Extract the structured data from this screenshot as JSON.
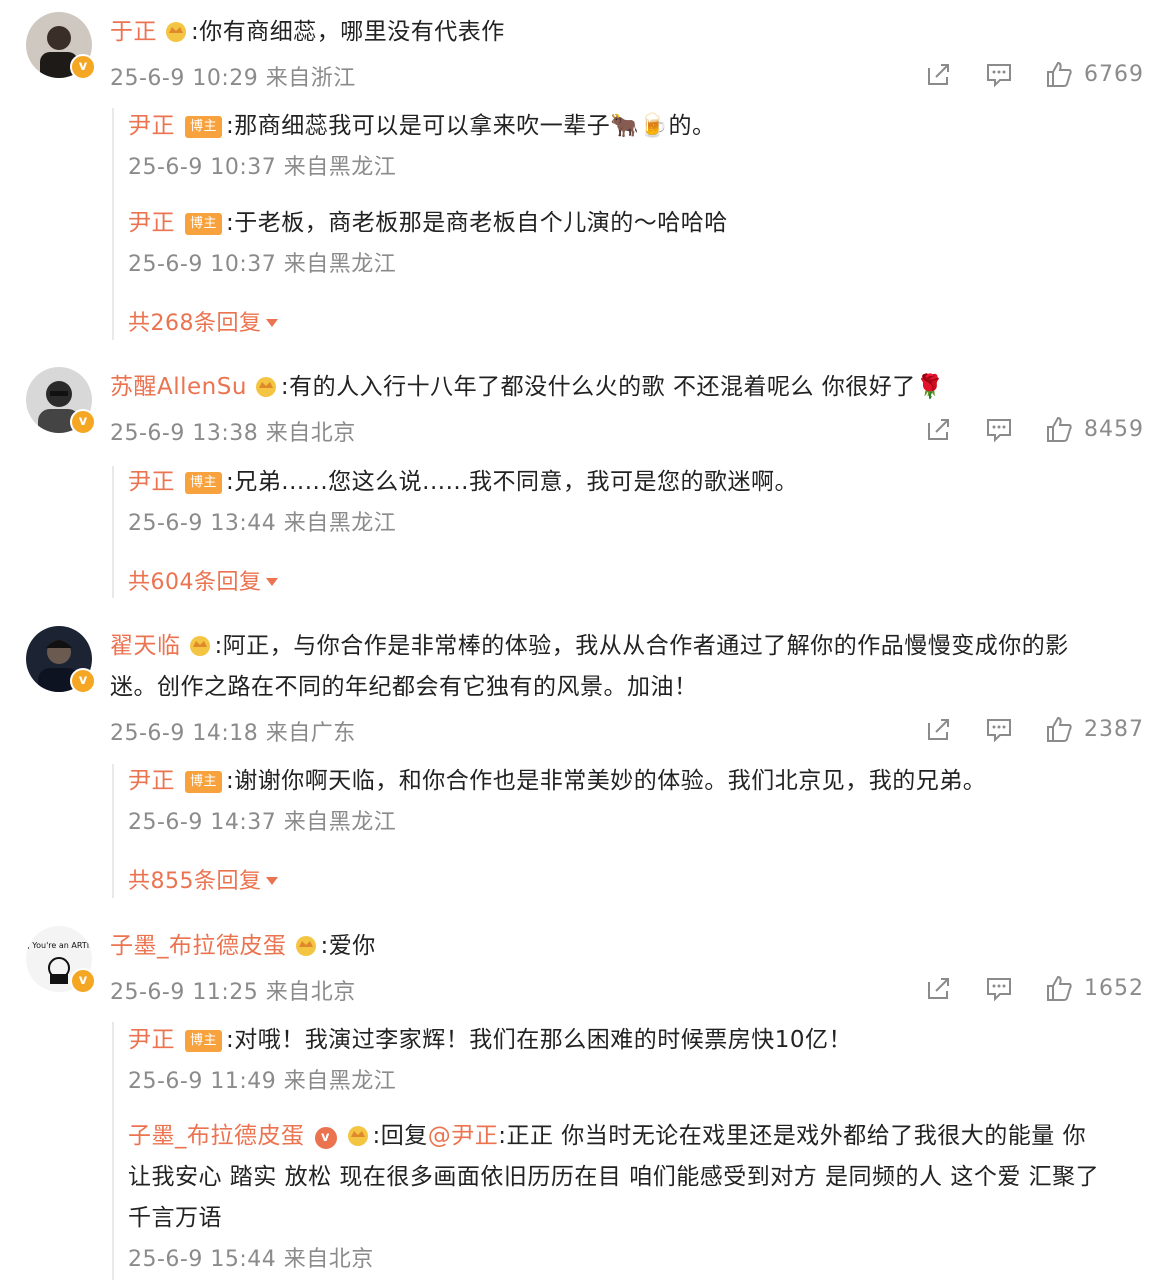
{
  "comments": [
    {
      "user": "于正",
      "text": ":你有商细蕊，哪里没有代表作",
      "meta": "25-6-9 10:29 来自浙江",
      "likes": "6769",
      "replies": [
        {
          "user": "尹正",
          "tag": "博主",
          "text": ":那商细蕊我可以是可以拿来吹一辈子🐂🍺的。",
          "meta": "25-6-9 10:37 来自黑龙江"
        },
        {
          "user": "尹正",
          "tag": "博主",
          "text": ":于老板，商老板那是商老板自个儿演的～哈哈哈",
          "meta": "25-6-9 10:37 来自黑龙江"
        }
      ],
      "more": "共268条回复"
    },
    {
      "user": "苏醒AllenSu",
      "text": ":有的人入行十八年了都没什么火的歌 不还混着呢么 你很好了🌹",
      "meta": "25-6-9 13:38 来自北京",
      "likes": "8459",
      "replies": [
        {
          "user": "尹正",
          "tag": "博主",
          "text": ":兄弟......您这么说......我不同意，我可是您的歌迷啊。",
          "meta": "25-6-9 13:44 来自黑龙江"
        }
      ],
      "more": "共604条回复"
    },
    {
      "user": "翟天临",
      "text_line1": ":阿正，与你合作是非常棒的体验，我从从合作者通过了解你的作品慢慢变成你的影",
      "text_line2": "迷。创作之路在不同的年纪都会有它独有的风景。加油！",
      "meta": "25-6-9 14:18 来自广东",
      "likes": "2387",
      "replies": [
        {
          "user": "尹正",
          "tag": "博主",
          "text": ":谢谢你啊天临，和你合作也是非常美妙的体验。我们北京见，我的兄弟。",
          "meta": "25-6-9 14:37 来自黑龙江"
        }
      ],
      "more": "共855条回复"
    },
    {
      "user": "子墨_布拉德皮蛋",
      "text": ":爱你",
      "meta": "25-6-9 11:25 来自北京",
      "likes": "1652",
      "replies": [
        {
          "user": "尹正",
          "tag": "博主",
          "text": ":对哦！我演过李家辉！我们在那么困难的时候票房快10亿！",
          "meta": "25-6-9 11:49 来自黑龙江"
        },
        {
          "user": "子墨_布拉德皮蛋",
          "reply_prefix": ":回复",
          "mention": "@尹正",
          "text_line1": ":正正 你当时无论在戏里还是戏外都给了我很大的能量 你",
          "text_line2": "让我安心 踏实 放松 现在很多画面依旧历历在目 咱们能感受到对方 是同频的人 这个爱 汇聚了",
          "text_line3": "千言万语",
          "meta": "25-6-9 15:44 来自北京"
        }
      ]
    }
  ],
  "avatar4_text": "Hi, You're an ARTIST",
  "icons": [
    "share-icon",
    "comment-icon",
    "like-icon",
    "crown-icon",
    "verified-icon"
  ],
  "colors": {
    "username": "#eb7350",
    "meta": "#8b8b8b",
    "tag": "#f7a23d",
    "badge": "#f5a623"
  }
}
